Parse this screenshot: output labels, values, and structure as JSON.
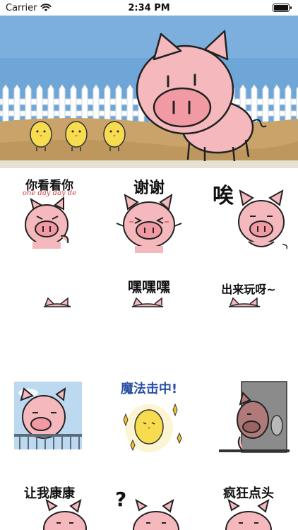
{
  "status_bar": {
    "carrier": "Carrier",
    "time": "2:34 PM",
    "battery_level": 1.0
  },
  "banner": {
    "sky_color": "#6fa6d8",
    "ground_color": "#c9a36a",
    "pig_color": "#f4b8bd",
    "chick_color": "#f7dc4f",
    "pig_icon": "pig-icon",
    "chick_icons": [
      "chick-icon",
      "chick-icon",
      "chick-icon"
    ]
  },
  "stickers": [
    {
      "caption": "你看看你",
      "subcaption": "one day day de",
      "icon": "pig-pointing-icon"
    },
    {
      "caption": "谢谢",
      "icon": "pig-thanks-icon"
    },
    {
      "caption": "唉",
      "icon": "pig-sigh-icon"
    },
    {
      "caption": "",
      "icon": "pig-peek-icon"
    },
    {
      "caption": "嘿嘿嘿",
      "icon": "pig-hehe-icon"
    },
    {
      "caption": "出来玩呀~",
      "icon": "pig-play-icon"
    },
    {
      "caption": "",
      "icon": "pig-fence-icon"
    },
    {
      "caption": "魔法击中!",
      "icon": "chick-magic-icon"
    },
    {
      "caption": "",
      "icon": "pig-door-icon"
    },
    {
      "caption": "让我康康",
      "icon": "pig-look-icon"
    },
    {
      "caption": "",
      "icon": "pig-question-icon"
    },
    {
      "caption": "疯狂点头",
      "icon": "pig-nod-icon"
    }
  ],
  "colors": {
    "pig_pink": "#f4b8bd",
    "outline": "#222222",
    "blush": "#e8707a"
  }
}
